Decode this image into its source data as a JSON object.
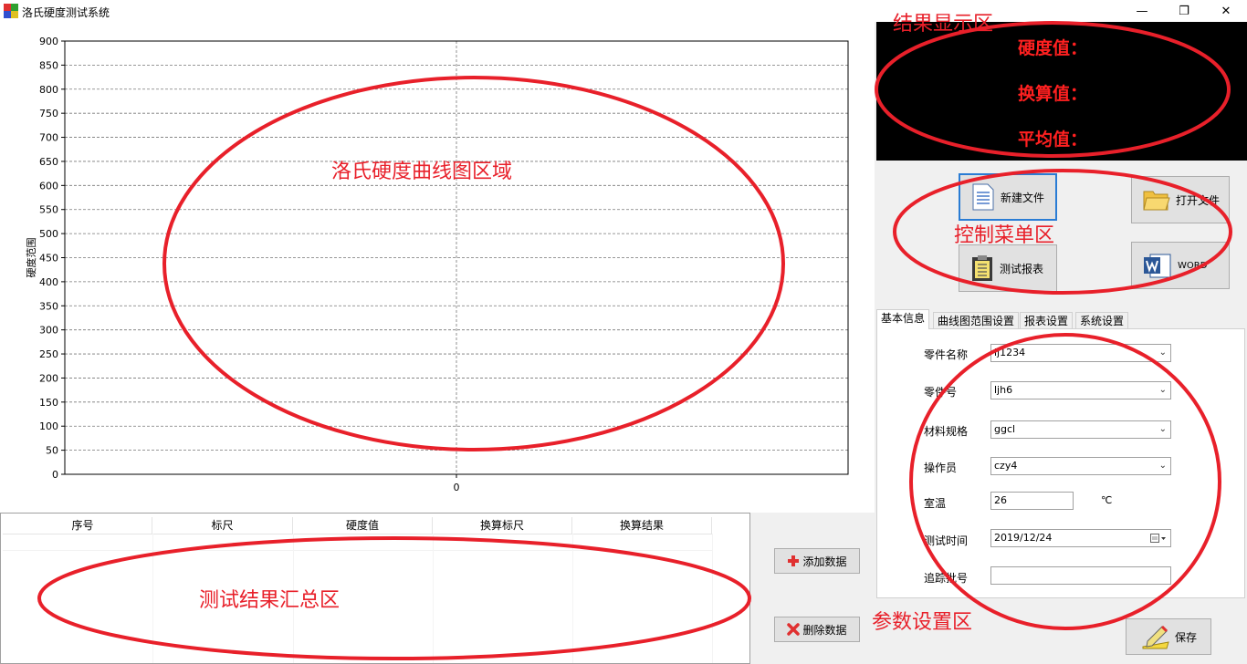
{
  "window": {
    "title": "洛氏硬度测试系统",
    "minimize": "—",
    "maximize": "❐",
    "close": "✕"
  },
  "chart_data": {
    "type": "line",
    "ylabel": "硬度范围",
    "xlabel": "",
    "ylim": [
      0,
      900
    ],
    "yticks": [
      0,
      50,
      100,
      150,
      200,
      250,
      300,
      350,
      400,
      450,
      500,
      550,
      600,
      650,
      700,
      750,
      800,
      850,
      900
    ],
    "xticks": [
      "0"
    ],
    "series": [],
    "grid": true
  },
  "table": {
    "columns": [
      "序号",
      "标尺",
      "硬度值",
      "换算标尺",
      "换算结果"
    ]
  },
  "buttons": {
    "add": "添加数据",
    "delete": "删除数据",
    "save": "保存"
  },
  "results": {
    "hardness": "硬度值：",
    "converted": "换算值：",
    "average": "平均值："
  },
  "controls": {
    "new_file": "新建文件",
    "open_file": "打开文件",
    "test_report": "测试报表",
    "word": "WORD"
  },
  "tabs": [
    "基本信息",
    "曲线图范围设置",
    "报表设置",
    "系统设置"
  ],
  "form": {
    "part_name_label": "零件名称",
    "part_name": "lj1234",
    "part_no_label": "零件号",
    "part_no": "ljh6",
    "material_label": "材料规格",
    "material": "ggcl",
    "operator_label": "操作员",
    "operator": "czy4",
    "room_temp_label": "室温",
    "room_temp": "26",
    "temp_unit": "℃",
    "test_time_label": "测试时间",
    "test_time": "2019/12/24",
    "trace_no_label": "追踪批号",
    "trace_no": ""
  },
  "annotations": {
    "result": "结果显示区",
    "chart": "洛氏硬度曲线图区域",
    "control": "控制菜单区",
    "summary": "测试结果汇总区",
    "params": "参数设置区"
  },
  "colors": {
    "annotation": "#e8202a",
    "result_text": "#ff2020",
    "result_bg": "#000000"
  }
}
